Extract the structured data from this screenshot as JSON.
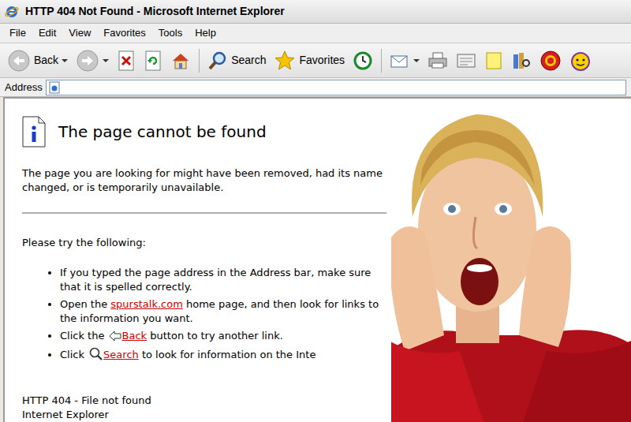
{
  "window": {
    "title": "HTTP 404 Not Found - Microsoft Internet Explorer"
  },
  "menu": [
    {
      "label": "File"
    },
    {
      "label": "Edit"
    },
    {
      "label": "View"
    },
    {
      "label": "Favorites"
    },
    {
      "label": "Tools"
    },
    {
      "label": "Help"
    }
  ],
  "toolbar": {
    "back": "Back",
    "search": "Search",
    "favorites": "Favorites"
  },
  "address_bar": {
    "label": "Address"
  },
  "page": {
    "heading": "The page cannot be found",
    "description": "The page you are looking for might have been removed, had its name changed, or is temporarily unavailable.",
    "prompt": "Please try the following:",
    "items": [
      {
        "segments": [
          {
            "kind": "text",
            "text": "If you typed the page address in the Address bar, make sure that it is spelled correctly."
          }
        ]
      },
      {
        "segments": [
          {
            "kind": "text",
            "text": "Open the "
          },
          {
            "kind": "link",
            "text": "spurstalk.com"
          },
          {
            "kind": "text",
            "text": " home page, and then look for links to the information you want."
          }
        ]
      },
      {
        "segments": [
          {
            "kind": "text",
            "text": "Click the "
          },
          {
            "kind": "back",
            "text": "Back"
          },
          {
            "kind": "text",
            "text": " button to try another link."
          }
        ]
      },
      {
        "segments": [
          {
            "kind": "text",
            "text": "Click "
          },
          {
            "kind": "search",
            "text": "Search"
          },
          {
            "kind": "text",
            "text": " to look for information on the Inte"
          }
        ]
      }
    ],
    "footer": [
      "HTTP 404 - File not found",
      "Internet Explorer"
    ]
  }
}
